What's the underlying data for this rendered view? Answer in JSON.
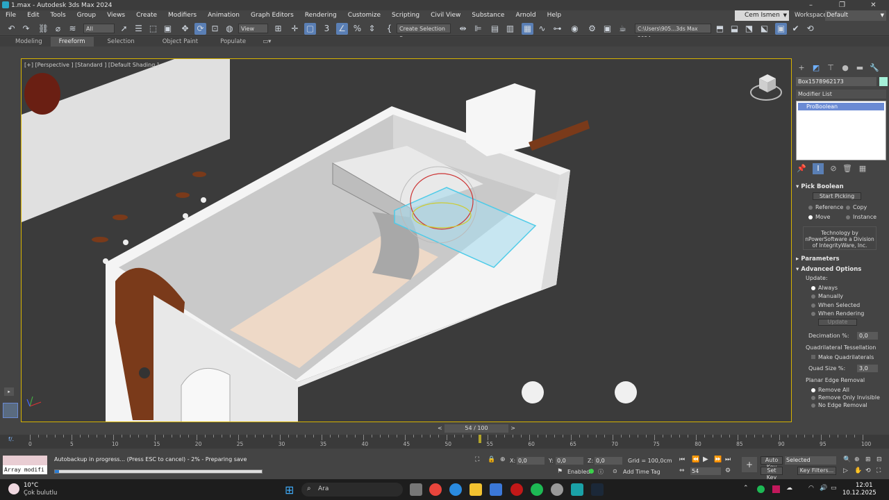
{
  "window": {
    "title": "1.max - Autodesk 3ds Max 2024"
  },
  "menu": [
    "File",
    "Edit",
    "Tools",
    "Group",
    "Views",
    "Create",
    "Modifiers",
    "Animation",
    "Graph Editors",
    "Rendering",
    "Customize",
    "Scripting",
    "Civil View",
    "Substance",
    "Arnold",
    "Help"
  ],
  "user": {
    "name": "Cem Ismen"
  },
  "workspaces": {
    "label": "Workspaces:",
    "value": "Default"
  },
  "toolbar": {
    "filter": "All",
    "refcoord": "View",
    "selset": "Create Selection Se",
    "path": "C:\\Users\\905...3ds Max 2024"
  },
  "ribbon": {
    "tabs": [
      "Modeling",
      "Freeform",
      "Selection",
      "Object Paint",
      "Populate"
    ],
    "active": "Freeform"
  },
  "viewport": {
    "label": "[+] [Perspective ] [Standard ] [Default Shading ]"
  },
  "command_panel": {
    "object_name": "Box1578962173",
    "modifier_list": "Modifier List",
    "modifier": "ProBoolean",
    "pick_boolean": "Pick Boolean",
    "start_picking": "Start Picking",
    "reference": "Reference",
    "copy": "Copy",
    "move": "Move",
    "instance": "Instance",
    "tech_line1": "Technology by",
    "tech_line2": "nPowerSoftware a Division",
    "tech_line3": "of IntegrityWare, Inc.",
    "parameters": "Parameters",
    "advanced": "Advanced Options",
    "update": "Update:",
    "always": "Always",
    "manually": "Manually",
    "when_selected": "When Selected",
    "when_rendering": "When Rendering",
    "update_btn": "Update",
    "decimation": "Decimation %:",
    "decimation_val": "0,0",
    "quad_tess": "Quadrilateral Tessellation",
    "make_quads": "Make Quadrilaterals",
    "quad_size": "Quad Size %:",
    "quad_size_val": "3,0",
    "planar": "Planar Edge Removal",
    "remove_all": "Remove All",
    "remove_only_invisible": "Remove Only Invisible",
    "no_edge_removal": "No Edge Removal"
  },
  "timeline": {
    "frame": "54 / 100",
    "ticks": [
      "0",
      "5",
      "10",
      "15",
      "20",
      "25",
      "30",
      "35",
      "40",
      "45",
      "50",
      "55",
      "60",
      "65",
      "70",
      "75",
      "80",
      "85",
      "90",
      "95",
      "100"
    ]
  },
  "status": {
    "script": "Array modifi",
    "message": "Autobackup in progress... (Press ESC to cancel)  -  2%  -  Preparing save",
    "progress": 2,
    "x_label": "X:",
    "x": "0,0",
    "y_label": "Y:",
    "y": "0,0",
    "z_label": "Z:",
    "z": "0,0",
    "grid": "Grid = 100,0cm",
    "enabled": "Enabled:",
    "add_time_tag": "Add Time Tag",
    "frame_field": "54",
    "auto_key": "Auto Key",
    "selected": "Selected",
    "set_key": "Set Key",
    "key_filters": "Key Filters..."
  },
  "taskbar": {
    "temp": "10°C",
    "weather": "Çok bulutlu",
    "search": "Ara",
    "time": "12:01",
    "date": "10.12.2025"
  },
  "colors": {
    "accent": "#d8b400",
    "selection": "#6a8ad4"
  }
}
